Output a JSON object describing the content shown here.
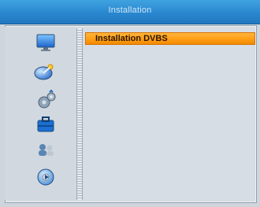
{
  "window": {
    "title": "Installation"
  },
  "menu": {
    "items": [
      {
        "label": "Installation DVBS",
        "selected": true
      }
    ]
  },
  "sidebar": {
    "icons": [
      "tv-monitor-icon",
      "satellite-dish-icon",
      "settings-gear-icon",
      "toolbox-icon",
      "users-icon",
      "media-disc-icon"
    ]
  },
  "colors": {
    "titlebar": "#2a87cf",
    "selection": "#ff9b13",
    "background": "#d6dce2"
  }
}
